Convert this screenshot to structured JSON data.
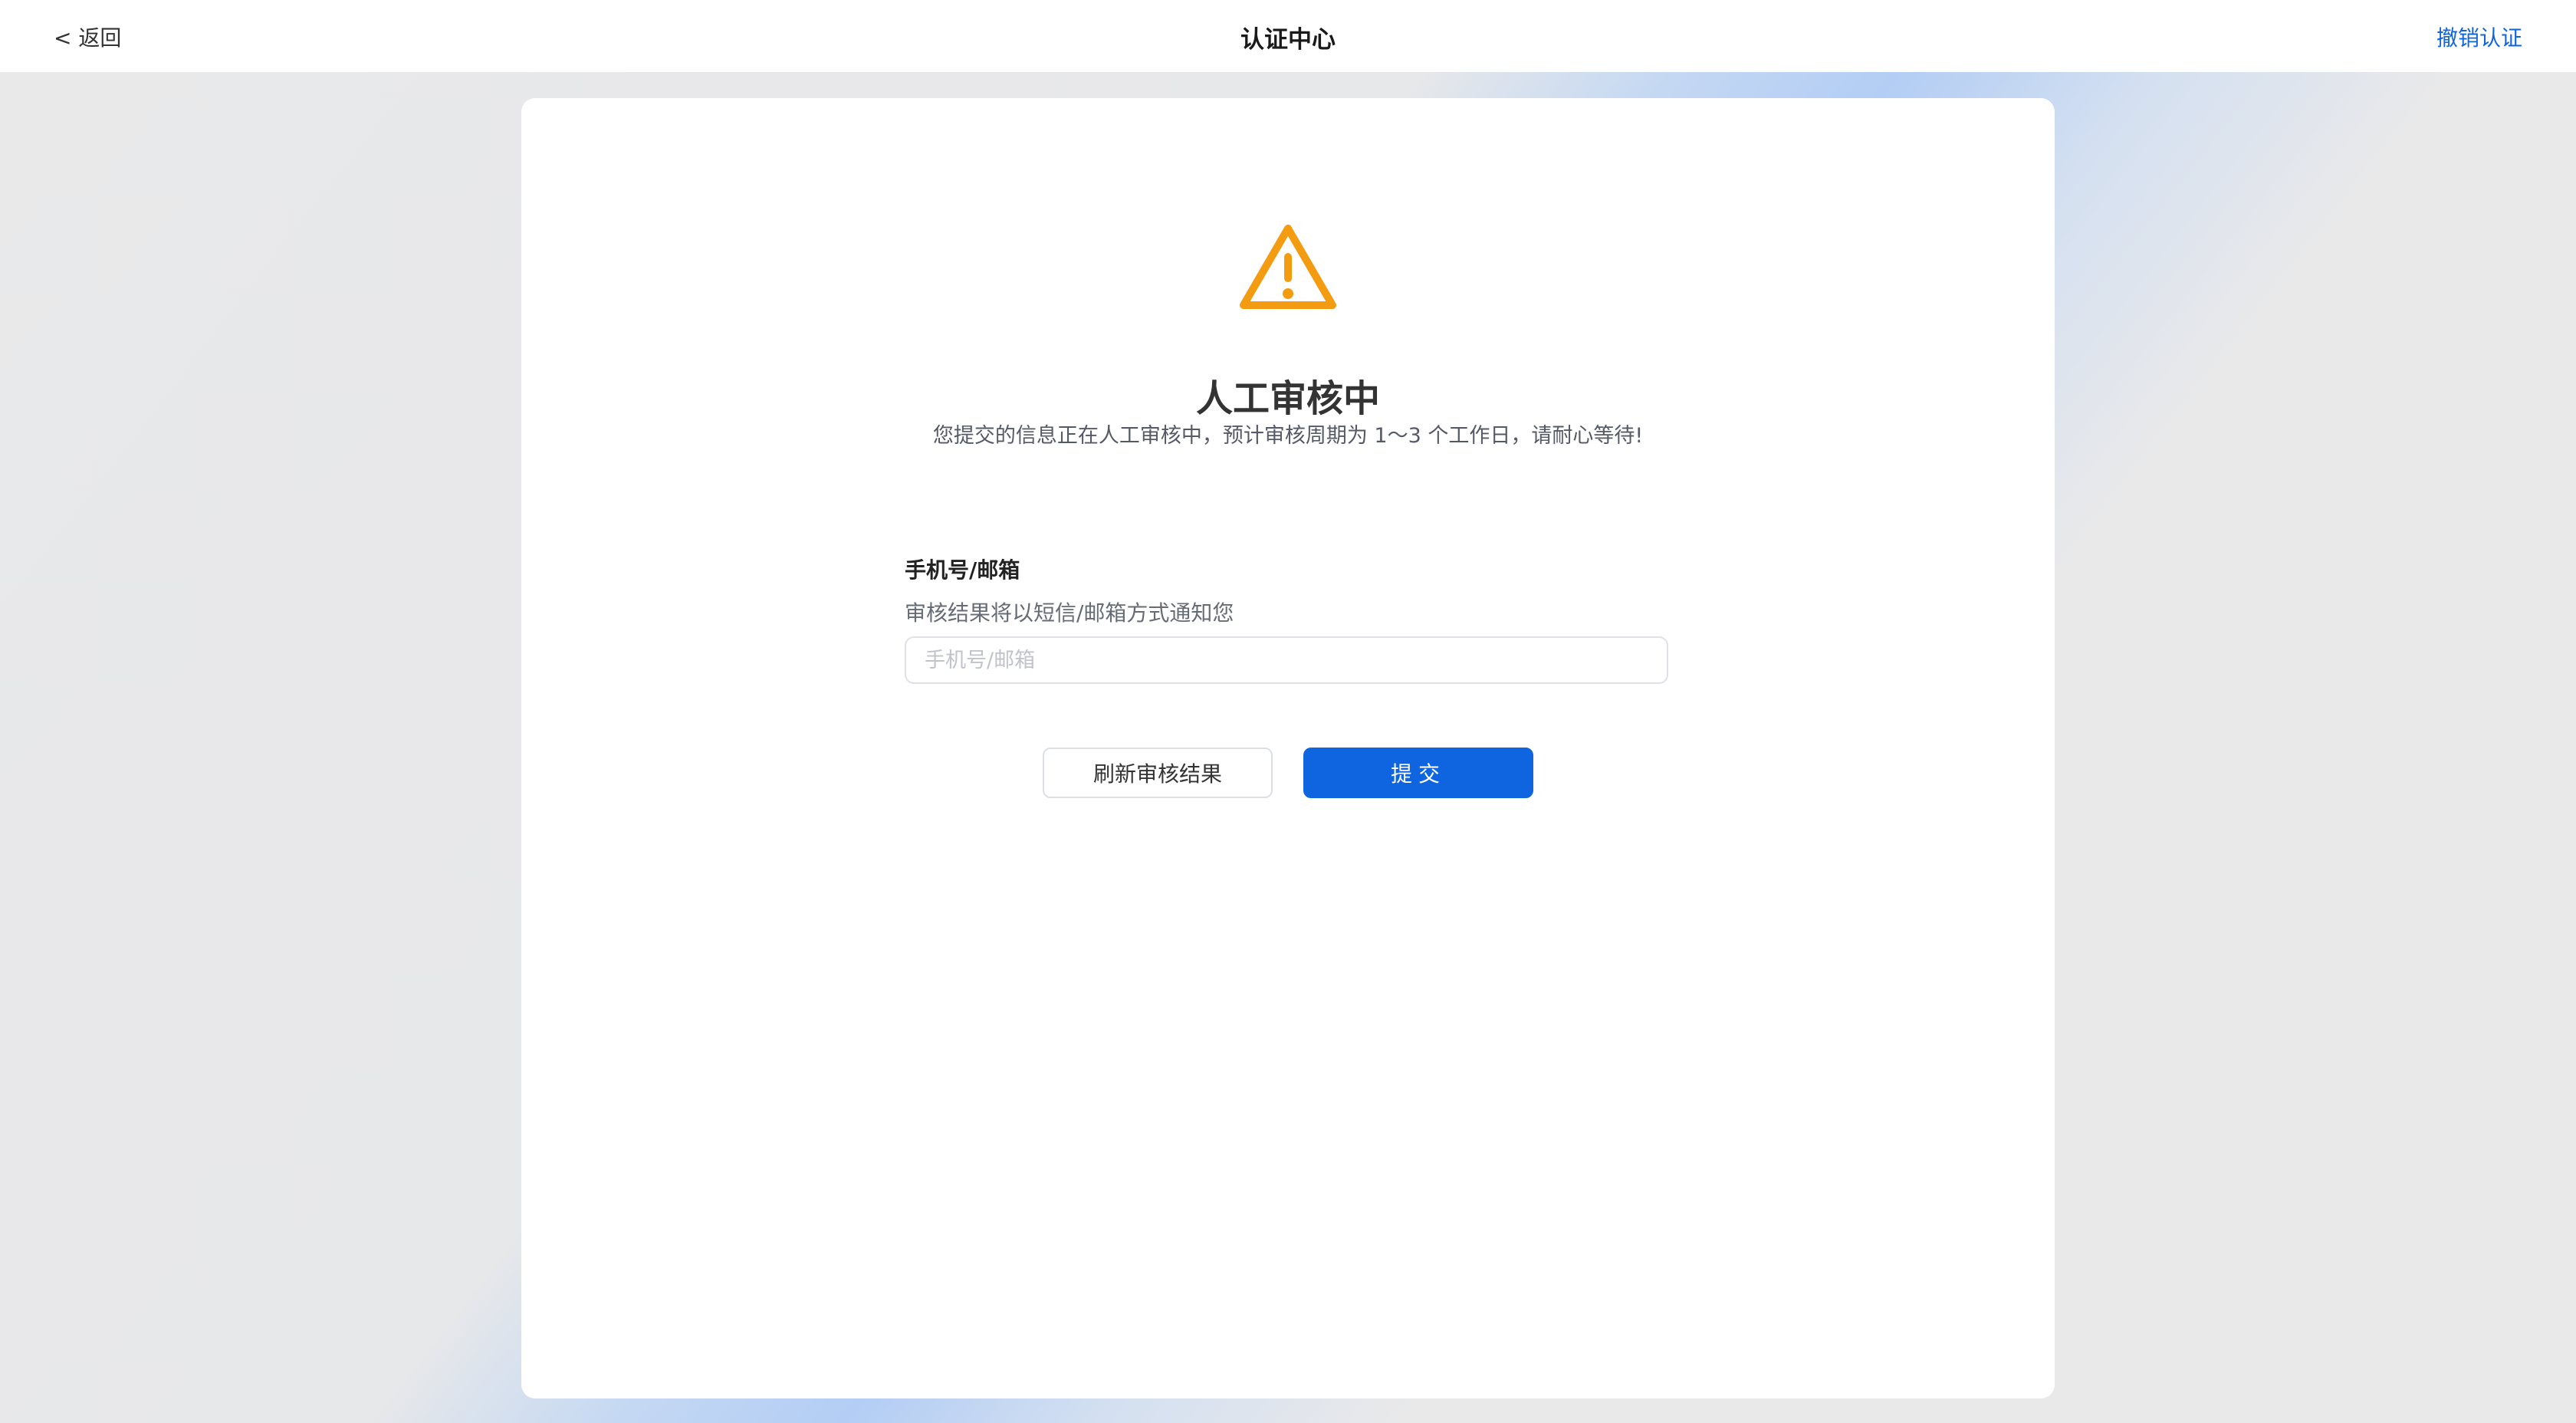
{
  "header": {
    "back_label": "< 返回",
    "title": "认证中心",
    "cancel_label": "撤销认证"
  },
  "status": {
    "icon": "warning-triangle-icon",
    "icon_color": "#F39C12",
    "title": "人工审核中",
    "description": "您提交的信息正在人工审核中，预计审核周期为 1～3 个工作日，请耐心等待!"
  },
  "contact_field": {
    "label": "手机号/邮箱",
    "hint": "审核结果将以短信/邮箱方式通知您",
    "value": "",
    "placeholder": "手机号/邮箱"
  },
  "actions": {
    "refresh_label": "刷新审核结果",
    "submit_label": "提交"
  },
  "colors": {
    "accent": "#0F65E0",
    "warning": "#F39C12"
  }
}
